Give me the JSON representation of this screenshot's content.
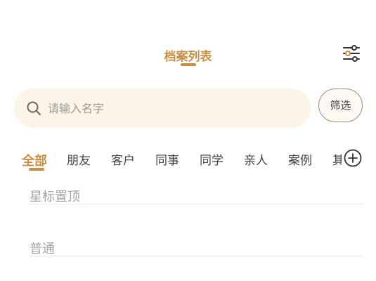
{
  "header": {
    "title": "档案列表",
    "accent_color": "#c68f45",
    "settings_icon": "sliders-icon"
  },
  "search": {
    "placeholder": "请输入名字",
    "value": "",
    "icon": "search-icon",
    "background": "#fdf4e8"
  },
  "filter": {
    "label": "筛选"
  },
  "tabs": [
    {
      "label": "全部",
      "active": true
    },
    {
      "label": "朋友",
      "active": false
    },
    {
      "label": "客户",
      "active": false
    },
    {
      "label": "同事",
      "active": false
    },
    {
      "label": "同学",
      "active": false
    },
    {
      "label": "亲人",
      "active": false
    },
    {
      "label": "案例",
      "active": false
    },
    {
      "label": "其",
      "active": false
    }
  ],
  "add_tab_icon": "plus-circle-icon",
  "sections": [
    {
      "label": "星标置顶"
    },
    {
      "label": "普通"
    }
  ]
}
